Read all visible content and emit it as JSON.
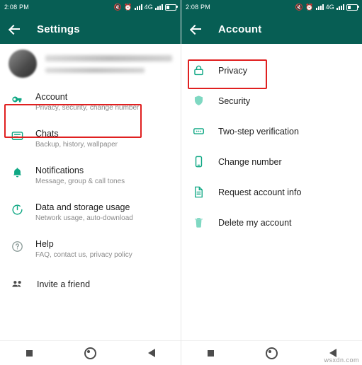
{
  "colors": {
    "appbar": "#075e54",
    "icon_teal": "#0fa884",
    "highlight": "#e02020",
    "primary_text": "#1f1f1f",
    "secondary_text": "#8a8a8a"
  },
  "left": {
    "statusbar": {
      "time": "2:08 PM",
      "icons": [
        "mute-icon",
        "alarm-icon",
        "signal-icon",
        "network-4g-icon",
        "signal2-icon",
        "battery-icon"
      ],
      "network": "4G"
    },
    "appbar": {
      "back": "back-arrow",
      "title": "Settings"
    },
    "profile": {
      "name_hidden": "",
      "status_hidden": ""
    },
    "items": [
      {
        "icon": "key-icon",
        "title": "Account",
        "subtitle": "Privacy, security, change number"
      },
      {
        "icon": "chat-icon",
        "title": "Chats",
        "subtitle": "Backup, history, wallpaper"
      },
      {
        "icon": "bell-icon",
        "title": "Notifications",
        "subtitle": "Message, group & call tones"
      },
      {
        "icon": "data-usage-icon",
        "title": "Data and storage usage",
        "subtitle": "Network usage, auto-download"
      },
      {
        "icon": "help-icon",
        "title": "Help",
        "subtitle": "FAQ, contact us, privacy policy"
      },
      {
        "icon": "people-icon",
        "title": "Invite a friend",
        "subtitle": ""
      }
    ],
    "highlight_target": "Account"
  },
  "right": {
    "statusbar": {
      "time": "2:08 PM",
      "icons": [
        "mute-icon",
        "alarm-icon",
        "signal-icon",
        "network-4g-icon",
        "signal2-icon",
        "battery-icon"
      ],
      "network": "4G"
    },
    "appbar": {
      "back": "back-arrow",
      "title": "Account"
    },
    "items": [
      {
        "icon": "lock-icon",
        "title": "Privacy"
      },
      {
        "icon": "shield-icon",
        "title": "Security"
      },
      {
        "icon": "two-step-icon",
        "title": "Two-step verification"
      },
      {
        "icon": "phone-icon",
        "title": "Change number"
      },
      {
        "icon": "document-icon",
        "title": "Request account info"
      },
      {
        "icon": "trash-icon",
        "title": "Delete my account"
      }
    ],
    "highlight_target": "Privacy"
  },
  "navbar": {
    "buttons": [
      "recents-square",
      "home-circle",
      "back-triangle"
    ]
  },
  "watermark": "wsxdn.com"
}
